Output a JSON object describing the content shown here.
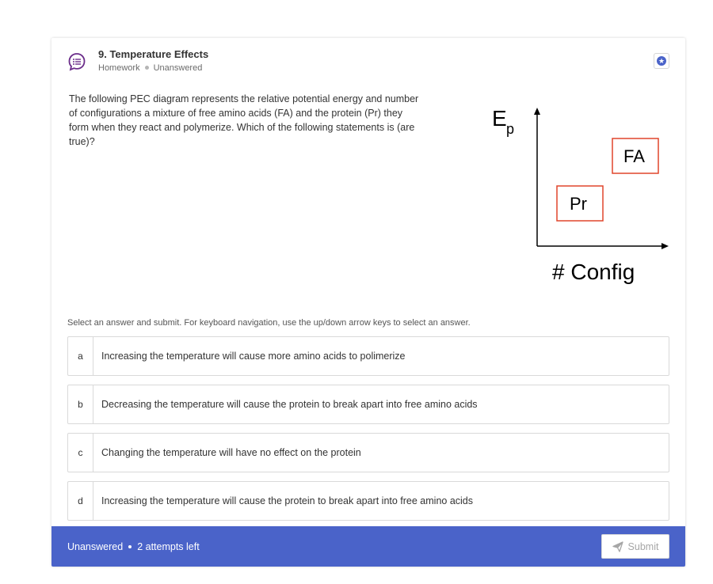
{
  "question": {
    "title": "9. Temperature Effects",
    "type": "Homework",
    "status": "Unanswered",
    "prompt": "The following PEC diagram represents the relative potential energy and number of configurations a mixture of free amino acids (FA) and the protein (Pr) they form when they react and polymerize. Which of the following statements is (are true)?",
    "icon": "question-list-icon",
    "bookmark_icon": "bookmark-icon"
  },
  "diagram": {
    "y_label_main": "E",
    "y_label_sub": "p",
    "x_label": "# Config",
    "box_fa": "FA",
    "box_pr": "Pr",
    "box_color": "#e0452b"
  },
  "instructions": "Select an answer and submit. For keyboard navigation, use the up/down arrow keys to select an answer.",
  "choices": [
    {
      "letter": "a",
      "text": "Increasing the temperature will cause more amino acids to polimerize"
    },
    {
      "letter": "b",
      "text": "Decreasing the temperature will cause the protein to break apart into free amino acids"
    },
    {
      "letter": "c",
      "text": "Changing the temperature will have no effect on the protein"
    },
    {
      "letter": "d",
      "text": "Increasing the temperature will cause the protein to break apart into free amino acids"
    }
  ],
  "footer": {
    "status": "Unanswered",
    "attempts": "2 attempts left",
    "submit_label": "Submit",
    "submit_icon": "send-icon",
    "accent_color": "#4a63c9"
  }
}
